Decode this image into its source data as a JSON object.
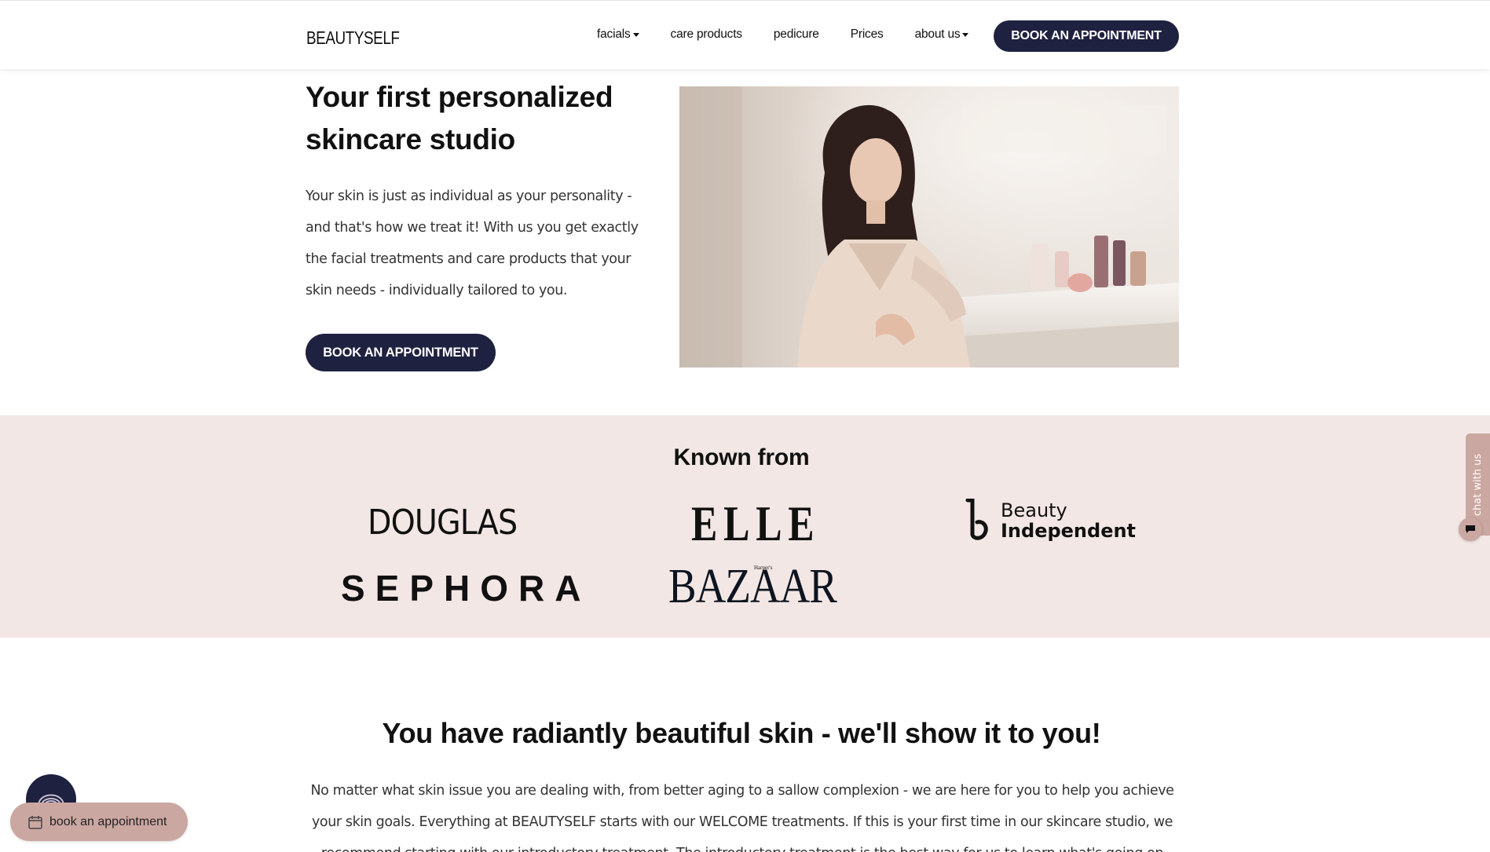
{
  "header": {
    "logo": "BEAUTYSELF",
    "nav": [
      {
        "label": "facials",
        "dropdown": true
      },
      {
        "label": "care products",
        "dropdown": false
      },
      {
        "label": "pedicure",
        "dropdown": false
      },
      {
        "label": "Prices",
        "dropdown": false
      },
      {
        "label": "about us",
        "dropdown": true
      }
    ],
    "cta": "BOOK AN APPOINTMENT"
  },
  "hero": {
    "title": "Your first personalized skincare studio",
    "text": "Your skin is just as individual as your personality - and that's how we treat it! With us you get exactly the facial treatments and care products that your skin needs - individually tailored to you.",
    "cta": "BOOK AN APPOINTMENT"
  },
  "known_from": {
    "title": "Known from",
    "brands": {
      "douglas": "DOUGLAS",
      "elle": "ELLE",
      "beauty_independent_1": "Beauty",
      "beauty_independent_2": "Independent",
      "sephora": "SEPHORA",
      "bazaar": "BAZAAR",
      "bazaar_small": "Harper's"
    }
  },
  "radiant": {
    "title": "You have radiantly beautiful skin - we'll show it to you!",
    "text": "No matter what skin issue you are dealing with, from better aging to a sallow complexion - we are here for you to help you achieve your skin goals. Everything at BEAUTYSELF starts with our WELCOME treatments. If this is your first time in our skincare studio, we recommend starting with our introductory treatment. The introductory treatment is the best way for us to learn what's going on"
  },
  "chat": {
    "label": "chat with us"
  },
  "booking_widget": {
    "label": "book an appointment"
  },
  "colors": {
    "navy": "#1f2140",
    "blush": "#f2e7e4",
    "rose": "#cba7a1"
  },
  "icons": [
    "caret-down-icon",
    "chat-icon",
    "fingerprint-icon",
    "calendar-icon",
    "beauty-independent-logo"
  ]
}
